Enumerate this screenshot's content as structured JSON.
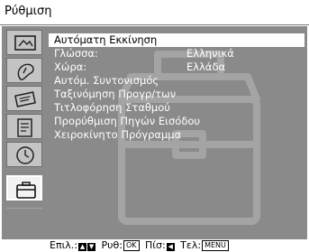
{
  "title": "Ρύθμιση",
  "menu_items": [
    {
      "label": "Αυτόματη Εκκίνηση",
      "value": "",
      "selected": true
    },
    {
      "label": "Γλώσσα:",
      "value": "Ελληνικά",
      "selected": false
    },
    {
      "label": "Χώρα:",
      "value": "Ελλάδα",
      "selected": false
    },
    {
      "label": "Αυτόμ. Συντονισμός",
      "value": "",
      "selected": false
    },
    {
      "label": "Ταξινόμηση Προγρ/των",
      "value": "",
      "selected": false
    },
    {
      "label": "Τιτλοφόρηση Σταθμού",
      "value": "",
      "selected": false
    },
    {
      "label": "Προρύθμιση Πηγών Εισόδου",
      "value": "",
      "selected": false
    },
    {
      "label": "Χειροκίνητο Πρόγραμμα",
      "value": "",
      "selected": false
    }
  ],
  "sidebar_icons": [
    "picture-icon",
    "sound-icon",
    "screen-icon",
    "features-icon",
    "timer-icon",
    "setup-icon"
  ],
  "active_sidebar_index": 5,
  "footer": {
    "select_label": "Επιλ.:",
    "adjust_label": "Ρυθ:",
    "adjust_key": "OK",
    "back_label": "Πίσ:",
    "exit_label": "Τελ:",
    "exit_key": "MENU"
  },
  "colors": {
    "panel": "#8a8a8a",
    "highlight": "#ffffff",
    "text": "#ffffff"
  }
}
